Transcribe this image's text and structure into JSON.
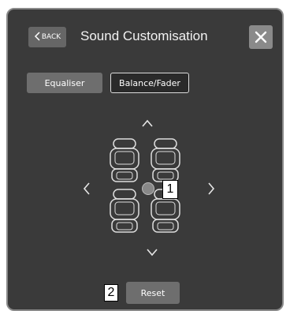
{
  "header": {
    "back_label": "BACK",
    "title": "Sound Customisation"
  },
  "tabs": [
    {
      "label": "Equaliser",
      "selected": false
    },
    {
      "label": "Balance/Fader",
      "selected": true
    }
  ],
  "callouts": {
    "one": "1",
    "two": "2"
  },
  "reset_label": "Reset",
  "icons": {
    "back": "chevron-left-icon",
    "close": "close-icon",
    "up": "chevron-up-icon",
    "down": "chevron-down-icon",
    "left": "chevron-left-icon",
    "right": "chevron-right-icon",
    "seat": "car-seat-icon"
  },
  "colors": {
    "screen_bg": "#3a3a3a",
    "button_bg": "#6e6e6e",
    "selected_border": "#dcdcdc"
  }
}
